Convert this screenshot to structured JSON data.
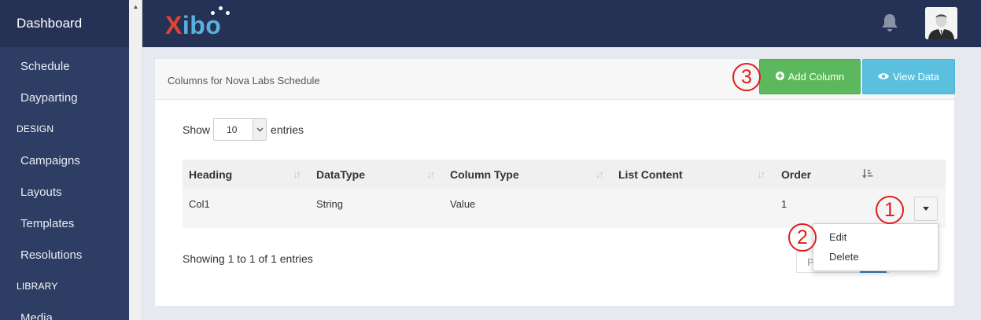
{
  "sidebar": {
    "brand": "Dashboard",
    "items": [
      {
        "label": "Schedule"
      },
      {
        "label": "Dayparting"
      },
      {
        "label": "Campaigns"
      },
      {
        "label": "Layouts"
      },
      {
        "label": "Templates"
      },
      {
        "label": "Resolutions"
      },
      {
        "label": "Media"
      }
    ],
    "headings": [
      "DESIGN",
      "LIBRARY"
    ]
  },
  "topbar": {
    "logo_first": "X",
    "logo_rest": "ibo",
    "bell_icon": "bell-icon",
    "avatar_icon": "user-avatar"
  },
  "card": {
    "title": "Columns for Nova Labs Schedule",
    "add_column_label": "Add Column",
    "view_data_label": "View Data"
  },
  "entries": {
    "show_label": "Show",
    "value": "10",
    "suffix": "entries"
  },
  "table": {
    "columns": [
      "Heading",
      "DataType",
      "Column Type",
      "List Content",
      "Order"
    ],
    "rows": [
      {
        "heading": "Col1",
        "datatype": "String",
        "column_type": "Value",
        "list_content": "",
        "order": "1"
      }
    ],
    "info": "Showing 1 to 1 of 1 entries",
    "pager_partial": "P"
  },
  "dropdown": {
    "items": [
      "Edit",
      "Delete"
    ]
  },
  "markers": [
    "1",
    "2",
    "3"
  ],
  "colors": {
    "sidebar": "#2e3d63",
    "topbar": "#253256",
    "success": "#5cb85c",
    "info": "#5bc0de",
    "marker": "#e01b1b"
  }
}
